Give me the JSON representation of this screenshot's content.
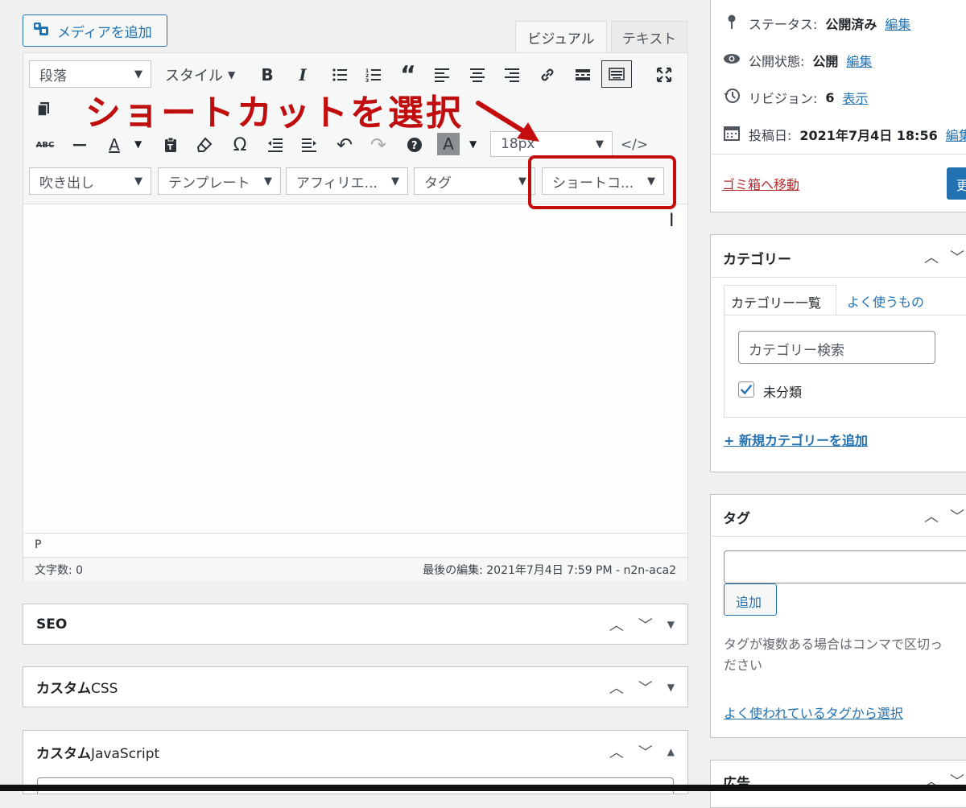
{
  "editor": {
    "media_button": "メディアを追加",
    "tabs": {
      "visual": "ビジュアル",
      "text": "テキスト"
    },
    "toolbar": {
      "format_select": "段落",
      "style_select": "スタイル",
      "font_size_select": "18px",
      "dropdowns": [
        "吹き出し",
        "テンプレート",
        "アフィリエ...",
        "タグ",
        "ショートコ..."
      ]
    },
    "status_path": "P",
    "word_count": "文字数: 0",
    "last_edit": "最後の編集: 2021年7月4日 7:59 PM - n2n-aca2"
  },
  "annotation": {
    "text": "ショートカットを選択",
    "color": "#c40e0e"
  },
  "panels": [
    {
      "title": "SEO"
    },
    {
      "title_bold": "カスタム",
      "title_rest": "CSS"
    },
    {
      "title_bold": "カスタム",
      "title_rest": "JavaScript"
    }
  ],
  "publish": {
    "status_label": "ステータス:",
    "status_value": "公開済み",
    "status_edit": "編集",
    "visibility_label": "公開状態:",
    "visibility_value": "公開",
    "visibility_edit": "編集",
    "revisions_label": "リビジョン:",
    "revisions_value": "6",
    "revisions_link": "表示",
    "date_label": "投稿日:",
    "date_value": "2021年7月4日 18:56",
    "date_edit": "編集",
    "trash_link": "ゴミ箱へ移動",
    "update_button": "更"
  },
  "categories": {
    "title": "カテゴリー",
    "tab_all": "カテゴリー一覧",
    "tab_popular": "よく使うもの",
    "search_value": "カテゴリー検索",
    "items": [
      {
        "label": "未分類",
        "checked": true
      }
    ],
    "add_link": "+ 新規カテゴリーを追加"
  },
  "tags": {
    "title": "タグ",
    "input_value": "",
    "add_button": "追加",
    "help_line1": "タグが複数ある場合はコンマで区切っ",
    "help_line2": "ださい",
    "popular_link": "よく使われているタグから選択"
  },
  "ads": {
    "title": "広告"
  },
  "colors": {
    "accent": "#2271b1",
    "annotation_red": "#c40e0e",
    "trash_red": "#b32d2e"
  }
}
